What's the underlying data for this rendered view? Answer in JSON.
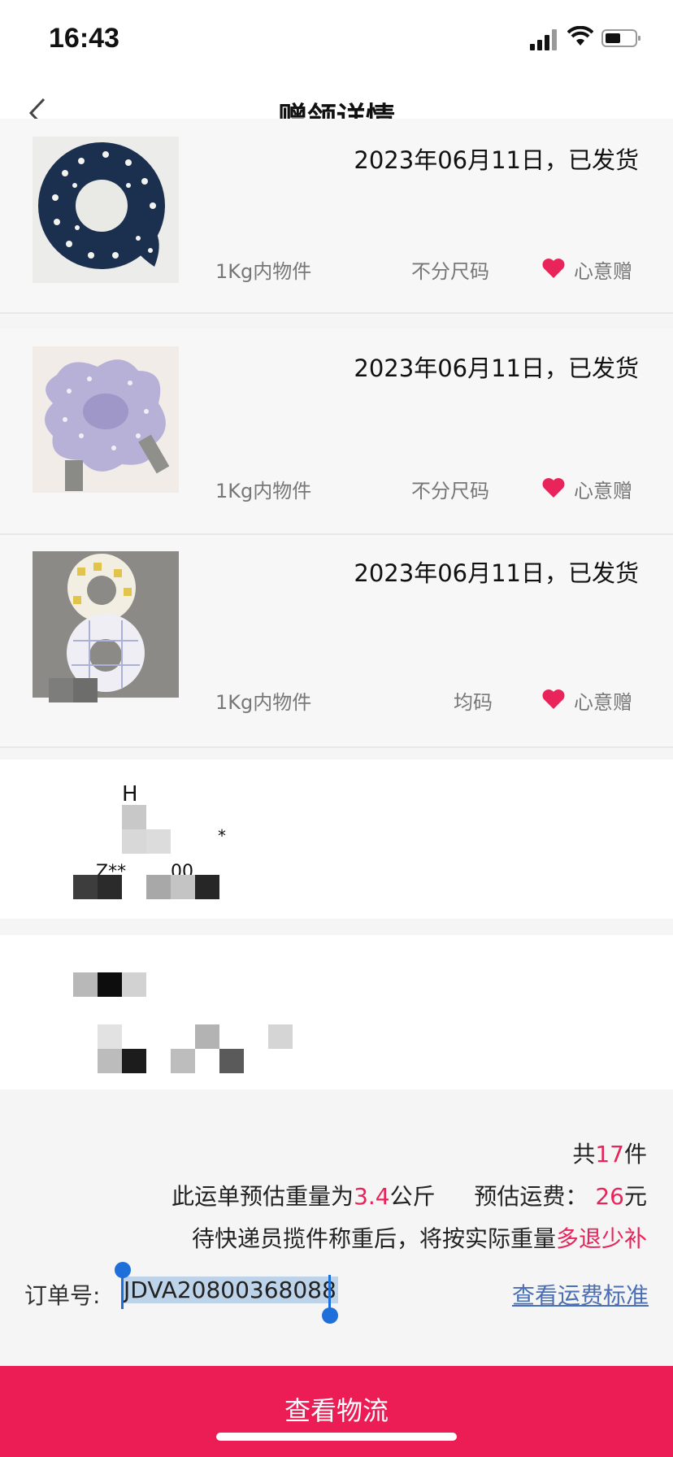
{
  "status_bar": {
    "time": "16:43"
  },
  "nav": {
    "title": "赠领详情"
  },
  "items": [
    {
      "date": "2023年06月11日，已发货",
      "weight": "1Kg内物件",
      "size": "不分尺码",
      "gift": "心意赠"
    },
    {
      "date": "2023年06月11日，已发货",
      "weight": "1Kg内物件",
      "size": "不分尺码",
      "gift": "心意赠"
    },
    {
      "date": "2023年06月11日，已发货",
      "weight": "1Kg内物件",
      "size": "均码",
      "gift": "心意赠"
    }
  ],
  "redacted": {
    "frag1": "H",
    "frag2": "*",
    "frag3": "Z**",
    "frag4": "00"
  },
  "summary": {
    "count_prefix": "共",
    "count": "17",
    "count_suffix": "件",
    "weight_prefix": "此运单预估重量为",
    "weight": "3.4",
    "weight_unit": "公斤",
    "fee_label": "预估运费：",
    "fee": "26",
    "fee_unit": "元",
    "note_prefix": "待快递员揽件称重后，将按实际重量",
    "note_highlight": "多退少补"
  },
  "order": {
    "label": "订单号:",
    "number": "JDVA20800368088",
    "fee_standard_link": "查看运费标准"
  },
  "action": {
    "label": "查看物流"
  },
  "colors": {
    "accent": "#ec1c54",
    "link": "#4a6fb5",
    "selection": "#1e6fd9"
  }
}
